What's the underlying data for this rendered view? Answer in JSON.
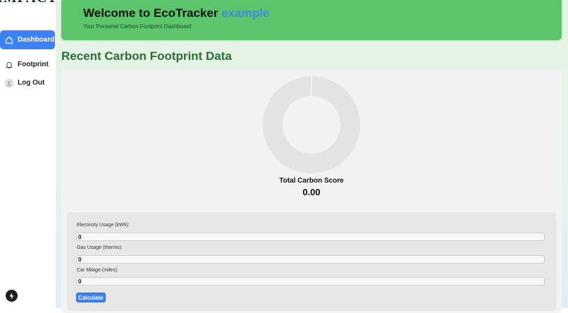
{
  "sidebar": {
    "logo": "IMPACT",
    "items": [
      {
        "label": "Dashboard",
        "icon": "home-icon",
        "active": true
      },
      {
        "label": "Footprint",
        "icon": "bell-icon",
        "active": false
      },
      {
        "label": "Log Out",
        "icon": "user-icon",
        "active": false
      }
    ],
    "bottom_icon": "bolt-icon"
  },
  "banner": {
    "title_prefix": "Welcome to EcoTracker ",
    "username": "example",
    "subtitle": "Your Personal Carbon Footprint Dashboard"
  },
  "section": {
    "title": "Recent Carbon Footprint Data"
  },
  "chart_data": {
    "type": "pie",
    "style": "donut",
    "values": [
      0
    ],
    "labels": [],
    "colors": [
      "#e3e3e3"
    ],
    "title": ""
  },
  "score": {
    "label": "Total Carbon Score",
    "value": "0.00"
  },
  "form": {
    "electricity_label": "Electricity Usage (kWh):",
    "electricity_value": "0",
    "gas_label": "Gas Usage (therms):",
    "gas_value": "0",
    "car_label": "Car Milage (miles):",
    "car_value": "0",
    "button_label": "Calculate"
  },
  "colors": {
    "accent": "#3b82f6",
    "banner": "#5cc46b",
    "section_title": "#2e6b3a",
    "username": "#3b8be8"
  }
}
